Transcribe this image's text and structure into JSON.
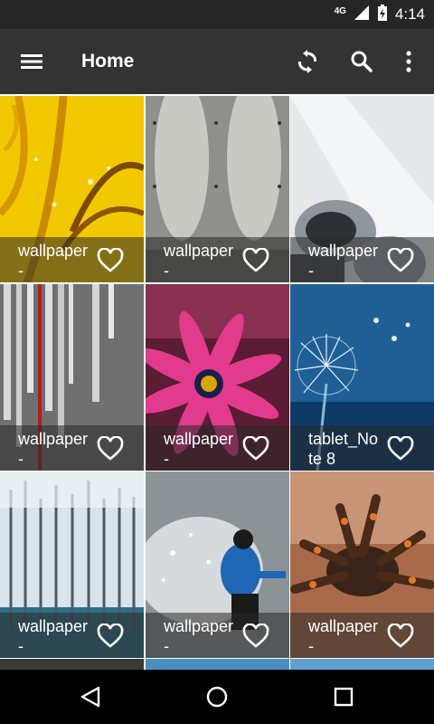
{
  "status_bar": {
    "network": "4G",
    "time": "4:14",
    "icons": [
      "signal-icon",
      "battery-charging-icon"
    ]
  },
  "app_bar": {
    "title": "Home",
    "icons": [
      "menu-icon",
      "refresh-icon",
      "search-icon",
      "more-vert-icon"
    ]
  },
  "wallpapers": [
    {
      "label": "wallpaper-",
      "favorited": false,
      "theme": "yellow-flower"
    },
    {
      "label": "wallpaper-",
      "favorited": false,
      "theme": "concrete-wall"
    },
    {
      "label": "wallpaper-",
      "favorited": false,
      "theme": "robot"
    },
    {
      "label": "wallpaper-",
      "favorited": false,
      "theme": "metal-bars"
    },
    {
      "label": "wallpaper-",
      "favorited": false,
      "theme": "pink-daisy"
    },
    {
      "label": "tablet_Note 8",
      "favorited": false,
      "theme": "dandelion"
    },
    {
      "label": "wallpaper-",
      "favorited": false,
      "theme": "snow-forest"
    },
    {
      "label": "wallpaper-",
      "favorited": false,
      "theme": "snowboarder"
    },
    {
      "label": "wallpaper-",
      "favorited": false,
      "theme": "spider"
    }
  ],
  "colors": {
    "app_bar": "#333333",
    "status_bar": "#262626",
    "nav_bar": "#000000"
  },
  "nav_bar": {
    "icons": [
      "back-icon",
      "home-icon",
      "recents-icon"
    ]
  }
}
